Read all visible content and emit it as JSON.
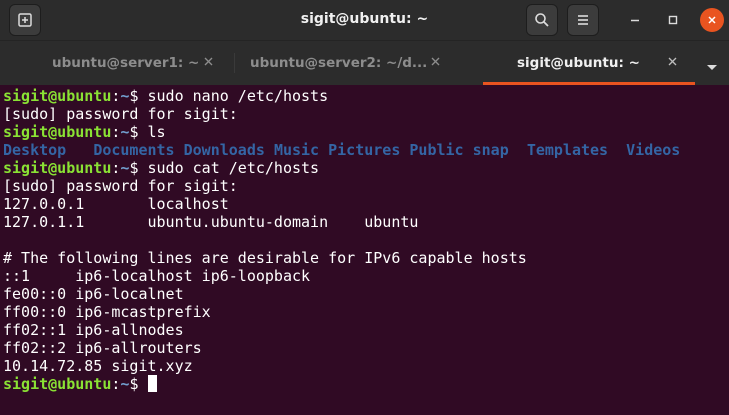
{
  "window": {
    "title": "sigit@ubuntu: ~"
  },
  "tabs": [
    {
      "label": "ubuntu@server1: ~",
      "active": false
    },
    {
      "label": "ubuntu@server2: ~/d...",
      "active": false
    },
    {
      "label": "sigit@ubuntu: ~",
      "active": true
    }
  ],
  "icons": {
    "new_tab": "new-tab-icon",
    "search": "search-icon",
    "menu": "hamburger-menu-icon",
    "minimize": "minimize-icon",
    "maximize": "maximize-icon",
    "close": "close-icon",
    "tab_close": "close-icon",
    "dropdown": "chevron-down-icon"
  },
  "colors": {
    "background": "#300a24",
    "titlebar": "#2c2c2c",
    "accent": "#e95420",
    "prompt_user": "#8ae234",
    "prompt_path": "#729fcf",
    "directory": "#3465a4",
    "text": "#ffffff"
  },
  "terminal": {
    "prompt": {
      "user_host": "sigit@ubuntu",
      "colon": ":",
      "path": "~",
      "symbol": "$ "
    },
    "lines": [
      {
        "type": "cmd",
        "text": "sudo nano /etc/hosts"
      },
      {
        "type": "out",
        "text": "[sudo] password for sigit:"
      },
      {
        "type": "cmd",
        "text": "ls"
      },
      {
        "type": "dirs",
        "items": [
          "Desktop",
          "Documents",
          "Downloads",
          "Music",
          "Pictures",
          "Public",
          "snap",
          "Templates",
          "Videos"
        ]
      },
      {
        "type": "cmd",
        "text": "sudo cat /etc/hosts"
      },
      {
        "type": "out",
        "text": "[sudo] password for sigit:"
      },
      {
        "type": "out",
        "text": "127.0.0.1       localhost"
      },
      {
        "type": "out",
        "text": "127.0.1.1       ubuntu.ubuntu-domain    ubuntu"
      },
      {
        "type": "out",
        "text": ""
      },
      {
        "type": "out",
        "text": "# The following lines are desirable for IPv6 capable hosts"
      },
      {
        "type": "out",
        "text": "::1     ip6-localhost ip6-loopback"
      },
      {
        "type": "out",
        "text": "fe00::0 ip6-localnet"
      },
      {
        "type": "out",
        "text": "ff00::0 ip6-mcastprefix"
      },
      {
        "type": "out",
        "text": "ff02::1 ip6-allnodes"
      },
      {
        "type": "out",
        "text": "ff02::2 ip6-allrouters"
      },
      {
        "type": "out",
        "text": "10.14.72.85 sigit.xyz"
      },
      {
        "type": "cursor",
        "text": ""
      }
    ]
  }
}
